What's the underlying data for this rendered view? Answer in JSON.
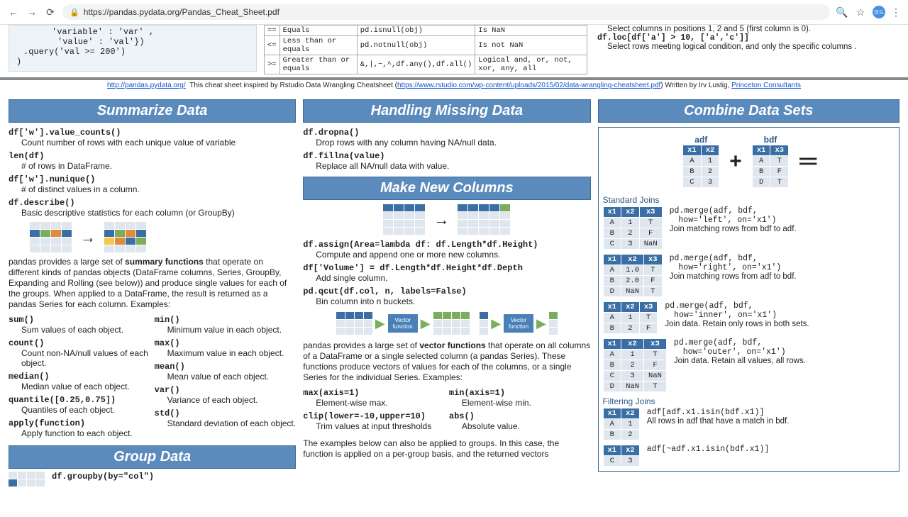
{
  "chrome": {
    "url": "https://pandas.pydata.org/Pandas_Cheat_Sheet.pdf"
  },
  "frag": {
    "code1": "'variable' : 'var' ,",
    "code2": "'value' : 'val'})",
    "code3": ".query('val >= 200')",
    "code4": ")",
    "op_rows": [
      [
        "==",
        "Equals",
        "pd.isnull(obj)",
        "Is NaN"
      ],
      [
        "<=",
        "Less than or equals",
        "pd.notnull(obj)",
        "Is not NaN"
      ],
      [
        ">=",
        "Greater than or equals",
        "&,|,~,^,df.any(),df.all()",
        "Logical and, or, not, xor, any, all"
      ]
    ],
    "r1": "Select columns in positions 1, 2 and 5 (first column is 0).",
    "r2": "df.loc[df['a'] > 10, ['a','c']]",
    "r3": "Select rows meeting logical condition, and only the specific columns .",
    "foot_a": "http://pandas.pydata.org/",
    "foot_mid": "This cheat sheet inspired by Rstudio Data Wrangling Cheatsheet (",
    "foot_b": "https://www.rstudio.com/wp-content/uploads/2015/02/data-wrangling-cheatsheet.pdf",
    "foot_end": ")  Written by Irv Lustig, ",
    "foot_c": "Princeton Consultants"
  },
  "summarize": {
    "title": "Summarize Data",
    "e1_code": "df['w'].value_counts()",
    "e1_desc": "Count number of rows with each unique value of variable",
    "e2_code": "len(df)",
    "e2_desc": "# of rows in DataFrame.",
    "e3_code": "df['w'].nunique()",
    "e3_desc": "# of distinct values in a column.",
    "e4_code": "df.describe()",
    "e4_desc": "Basic descriptive statistics for each column (or GroupBy)",
    "para1a": "pandas provides a large set of ",
    "para1b": "summary functions",
    "para1c": " that operate on different kinds of pandas objects (DataFrame columns, Series, GroupBy, Expanding and Rolling (see below)) and produce single values for each of the groups. When applied to a DataFrame, the result is returned as a pandas Series for each column. Examples:",
    "l1_code": "sum()",
    "l1_desc": "Sum values of each object.",
    "l2_code": "count()",
    "l2_desc": "Count non-NA/null values of each object.",
    "l3_code": "median()",
    "l3_desc": "Median value of each object.",
    "l4_code": "quantile([0.25,0.75])",
    "l4_desc": "Quantiles of each object.",
    "l5_code": "apply(function)",
    "l5_desc": "Apply function to each object.",
    "r1_code": "min()",
    "r1_desc": "Minimum value in each object.",
    "r2_code": "max()",
    "r2_desc": "Maximum value in each object.",
    "r3_code": "mean()",
    "r3_desc": "Mean value of each object.",
    "r4_code": "var()",
    "r4_desc": "Variance of each object.",
    "r5_code": "std()",
    "r5_desc": "Standard deviation of each object."
  },
  "group": {
    "title": "Group Data",
    "c1": "df.groupby(by=\"col\")"
  },
  "missing": {
    "title": "Handling Missing Data",
    "e1_code": "df.dropna()",
    "e1_desc": "Drop rows with any column having NA/null data.",
    "e2_code": "df.fillna(value)",
    "e2_desc": "Replace all NA/null data with value."
  },
  "newcols": {
    "title": "Make New Columns",
    "e1_code": "df.assign(Area=lambda df: df.Length*df.Height)",
    "e1_desc": "Compute and append one or more new columns.",
    "e2_code": "df['Volume'] = df.Length*df.Height*df.Depth",
    "e2_desc": "Add single column.",
    "e3_code": "pd.qcut(df.col, n, labels=False)",
    "e3_desc": "Bin column into n buckets.",
    "vec_lbl": "Vector function",
    "para1a": "pandas provides a large set of ",
    "para1b": "vector functions",
    "para1c": " that operate on all columns of a DataFrame or a single selected column (a pandas Series). These functions produce vectors of values for each of the columns, or a single Series for the individual Series. Examples:",
    "l1_code": "max(axis=1)",
    "l1_desc": "Element-wise max.",
    "l2_code": "clip(lower=-10,upper=10)",
    "l2_desc": "Trim values at input thresholds",
    "r1_code": "min(axis=1)",
    "r1_desc": "Element-wise min.",
    "r2_code": "abs()",
    "r2_desc": "Absolute value.",
    "para2": "The examples below can also be applied to groups. In this case, the function is applied on a per-group basis, and the returned vectors"
  },
  "combine": {
    "title": "Combine Data Sets",
    "adf": "adf",
    "bdf": "bdf",
    "std_joins": "Standard Joins",
    "j1_code1": "pd.merge(adf, bdf,",
    "j1_code2": "how='left', on='x1')",
    "j1_desc": "Join matching rows from bdf to adf.",
    "j2_code1": "pd.merge(adf, bdf,",
    "j2_code2": "how='right', on='x1')",
    "j2_desc": "Join matching rows from adf to bdf.",
    "j3_code1": "pd.merge(adf, bdf,",
    "j3_code2": "how='inner', on='x1')",
    "j3_desc": "Join data. Retain only rows in both sets.",
    "j4_code1": "pd.merge(adf, bdf,",
    "j4_code2": "how='outer', on='x1')",
    "j4_desc": "Join data. Retain all values, all rows.",
    "filt_joins": "Filtering Joins",
    "f1_code": "adf[adf.x1.isin(bdf.x1)]",
    "f1_desc": "All rows in adf that have a match in bdf.",
    "f2_code": "adf[~adf.x1.isin(bdf.x1)]"
  }
}
